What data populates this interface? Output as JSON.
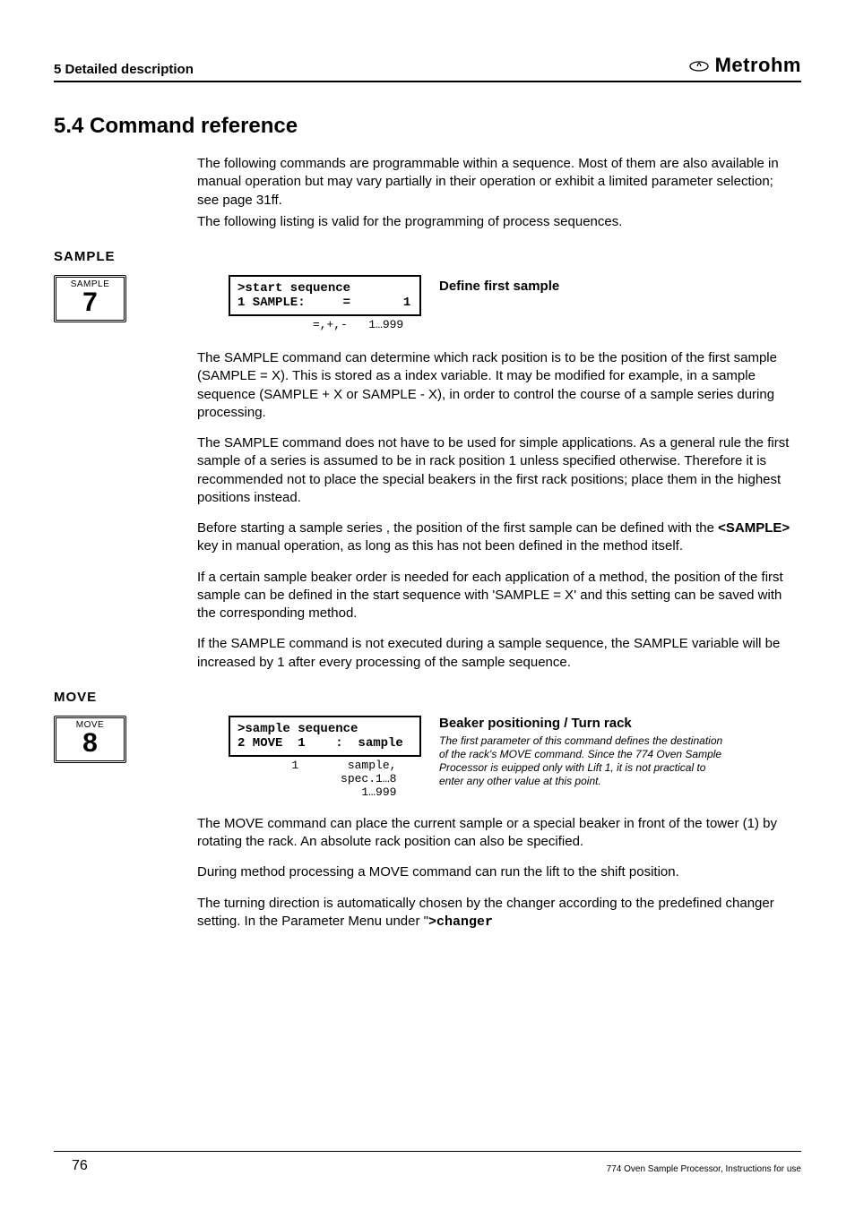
{
  "header": {
    "section_label": "5 Detailed description",
    "brand": "Metrohm"
  },
  "title": "5.4  Command reference",
  "intro_lines": [
    "The following commands are programmable within a sequence.  Most of them are also available in manual operation but may vary partially in their operation or exhibit a limited parameter selection; see page 31ff.",
    "The following listing is valid for the programming of process sequences."
  ],
  "sample": {
    "heading": "SAMPLE",
    "key_label": "SAMPLE",
    "key_number": "7",
    "lcd_line1": ">start sequence",
    "lcd_line2": "1 SAMPLE:     =       1",
    "range_line": "           =,+,-   1…999",
    "cmd_title": "Define first sample",
    "paras": [
      "The SAMPLE command can determine which rack position is to be the position of the first sample (SAMPLE = X).  This is stored as a index variable. It may be modified for example, in a sample sequence (SAMPLE + X or SAMPLE - X), in order to control the course of a sample series during processing.",
      "The SAMPLE command does not have to be used for simple applications. As a general rule the first sample of a series is assumed to be in rack position 1 unless specified otherwise.  Therefore it is recommended not to place the special beakers in the first rack positions; place them in the highest positions instead.",
      "Before starting a sample series , the position of the first sample can be defined with the  <SAMPLE>  key in manual operation, as long as this has not been defined in the method itself.",
      "If a certain sample beaker order is needed for each application of a method, the position of the first sample can be defined in the start sequence with 'SAMPLE = X' and this setting can be saved with the corresponding method.",
      "If the SAMPLE command is not executed during a sample sequence, the SAMPLE variable will be increased by 1 after every processing of the sample sequence."
    ],
    "bold_key_inline": "<SAMPLE>"
  },
  "move": {
    "heading": "MOVE",
    "key_label": "MOVE",
    "key_number": "8",
    "lcd_line1": ">sample sequence",
    "lcd_line2": "2 MOVE  1    :  sample",
    "range_ln1": "        1       sample,",
    "range_ln2": "               spec.1…8",
    "range_ln3": "                  1…999",
    "cmd_title": "Beaker positioning / Turn rack",
    "cmd_desc": "The first parameter of this command defines the destination of the rack's MOVE command. Since the 774 Oven Sample Processor is euipped only with Lift 1, it is not practical to enter any other value at this point.",
    "paras": [
      "The MOVE command can place the current sample or a special beaker in front of the tower (1) by rotating the rack.  An absolute rack position can also be specified.",
      "During method processing a MOVE command can run the lift to the shift position.",
      "The turning direction is automatically chosen by the changer according to the predefined changer setting.  In the Parameter Menu under \">changer"
    ],
    "changer_bold": ">changer"
  },
  "footer": {
    "page": "76",
    "doc": "774 Oven Sample Processor, Instructions for use"
  }
}
